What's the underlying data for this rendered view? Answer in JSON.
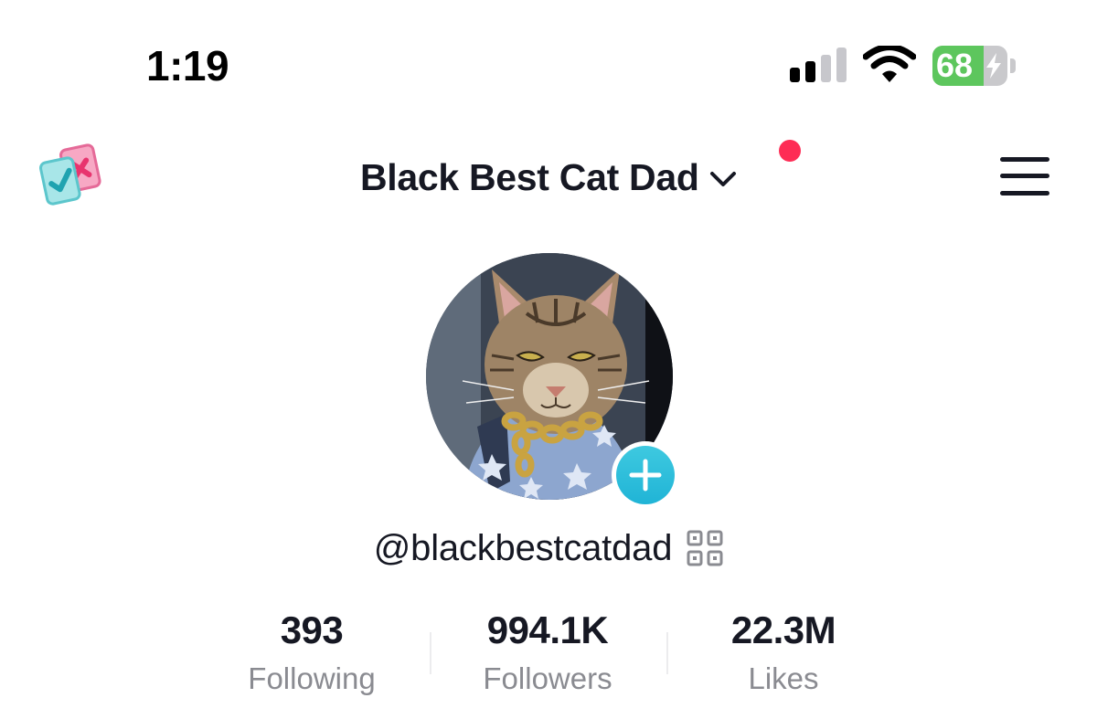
{
  "status_bar": {
    "time": "1:19",
    "battery_percent": "68",
    "battery_level": 0.68,
    "signal_bars_active": 2,
    "icons": [
      "cellular-signal-icon",
      "wifi-icon",
      "battery-charging-icon"
    ]
  },
  "header": {
    "title": "Black Best Cat Dad",
    "has_notification_dot": true,
    "icons": [
      "cards-check-cross-icon",
      "chevron-down-icon",
      "hamburger-menu-icon"
    ]
  },
  "profile": {
    "avatar_subject": "tabby cat wearing a blue star hoodie and gold chain",
    "username": "@blackbestcatdad",
    "icons": [
      "add-plus-icon",
      "qr-code-icon"
    ]
  },
  "stats": [
    {
      "value": "393",
      "label": "Following"
    },
    {
      "value": "994.1K",
      "label": "Followers"
    },
    {
      "value": "22.3M",
      "label": "Likes"
    }
  ],
  "colors": {
    "text_primary": "#161823",
    "text_secondary": "#8a8b91",
    "notification_red": "#fe2c55",
    "add_button": "#20b4d6",
    "battery_green": "#5dc65d"
  }
}
